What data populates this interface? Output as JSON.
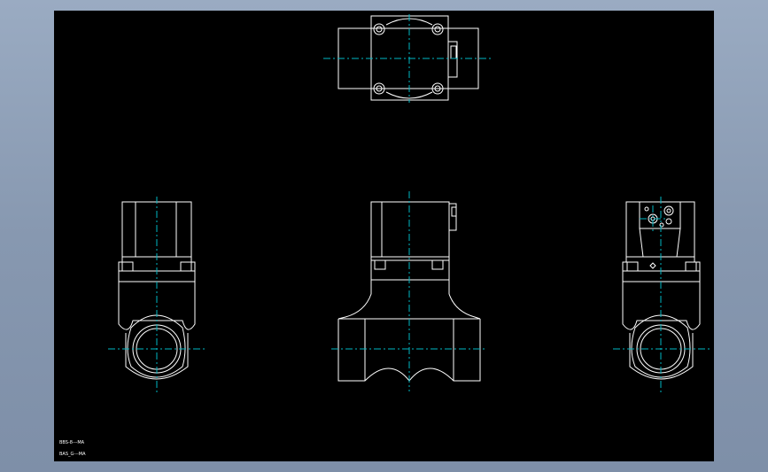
{
  "drawing": {
    "colors": {
      "background": "#8d9eb6",
      "sheet": "#000000",
      "outline": "#ffffff",
      "centerline": "#00b7c3"
    },
    "notes": [
      {
        "text": "BBS-8---MA"
      },
      {
        "text": "BAS_G---MA"
      }
    ]
  }
}
